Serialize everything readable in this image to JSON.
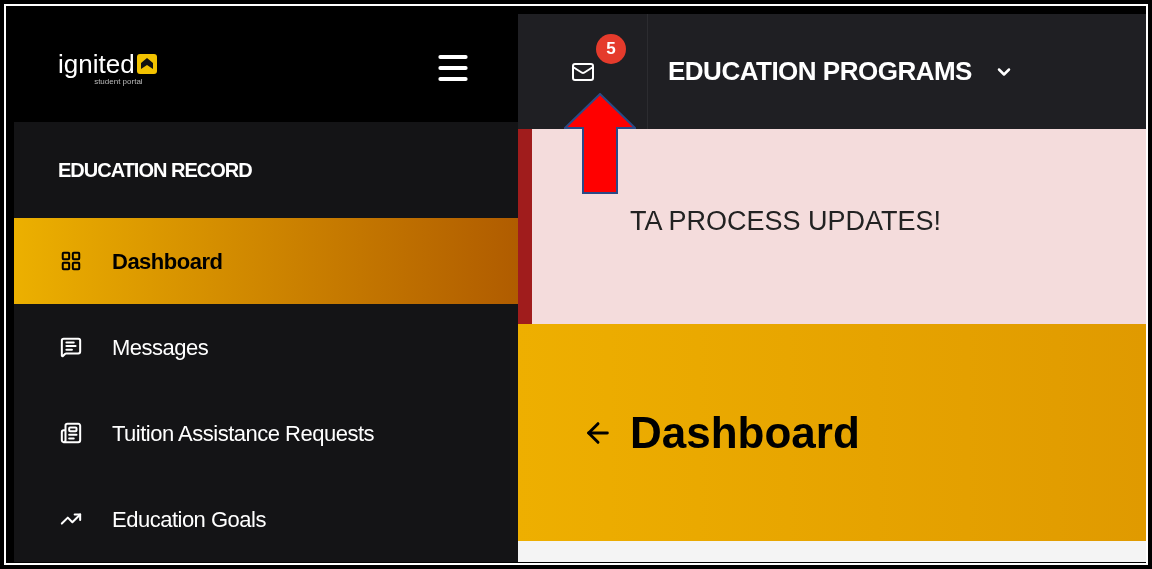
{
  "logo": {
    "name": "ignited",
    "subtitle": "student portal"
  },
  "notifications": {
    "count": "5"
  },
  "program_menu": {
    "label": "EDUCATION PROGRAMS"
  },
  "sidebar": {
    "section_title": "EDUCATION RECORD",
    "items": [
      {
        "label": "Dashboard",
        "kind": "grid",
        "selected": true
      },
      {
        "label": "Messages",
        "kind": "chat",
        "selected": false
      },
      {
        "label": "Tuition Assistance Requests",
        "kind": "docs",
        "selected": false
      },
      {
        "label": "Education Goals",
        "kind": "trend",
        "selected": false
      }
    ]
  },
  "banner": {
    "text": "TA PROCESS UPDATES!"
  },
  "page_header": {
    "title": "Dashboard"
  }
}
